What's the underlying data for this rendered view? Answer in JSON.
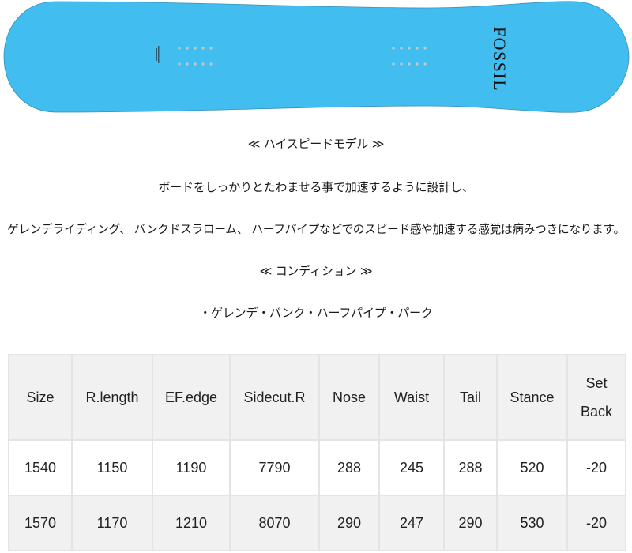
{
  "product": {
    "brand_text": "FOSSIL",
    "board_color": "#41bdef",
    "insert_color": "#c8c8c8",
    "brand_color": "#111111"
  },
  "description": {
    "model_heading": "≪ ハイスピードモデル ≫",
    "line1": "ボードをしっかりとたわませる事で加速するように設計し、",
    "line2": "ゲレンデライディング、 バンクドスラローム、 ハーフパイプなどでのスピード感や加速する感覚は病みつきになります。",
    "condition_heading": "≪ コンディション ≫",
    "conditions": "・ゲレンデ・バンク・ハーフパイプ・パーク"
  },
  "spec_table": {
    "headers": [
      "Size",
      "R.length",
      "EF.edge",
      "Sidecut.R",
      "Nose",
      "Waist",
      "Tail",
      "Stance",
      "Set",
      "Back"
    ],
    "rows": [
      [
        "1540",
        "1150",
        "1190",
        "7790",
        "288",
        "245",
        "288",
        "520",
        "-20"
      ],
      [
        "1570",
        "1170",
        "1210",
        "8070",
        "290",
        "247",
        "290",
        "530",
        "-20"
      ]
    ]
  }
}
